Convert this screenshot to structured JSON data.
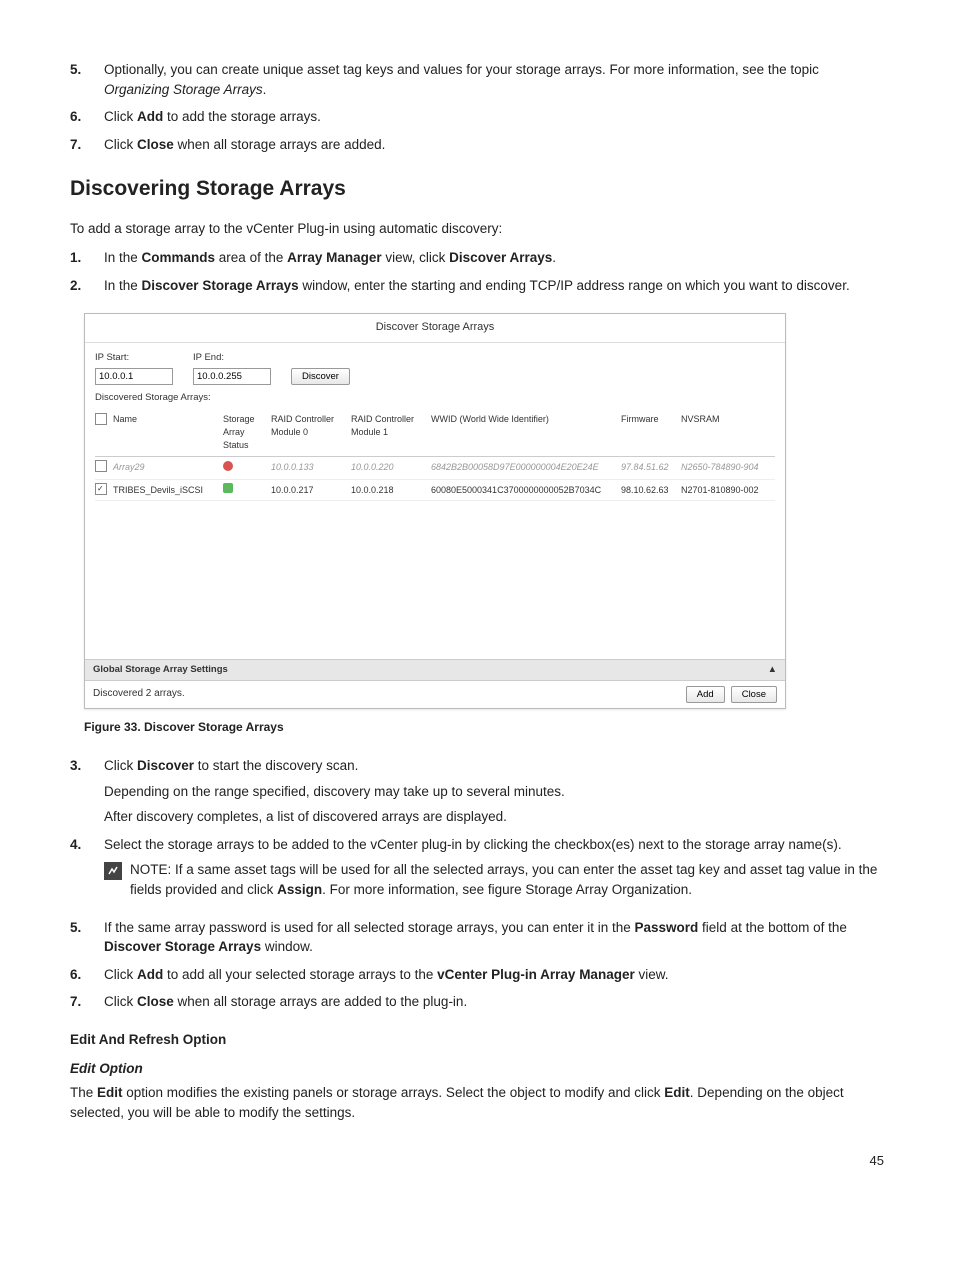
{
  "topSteps": {
    "s5": {
      "num": "5.",
      "text_a": "Optionally, you can create unique asset tag keys and values for your storage arrays. For more information, see the topic ",
      "text_b": "Organizing Storage Arrays",
      "text_c": "."
    },
    "s6": {
      "num": "6.",
      "a": "Click ",
      "b": "Add",
      "c": " to add the storage arrays."
    },
    "s7": {
      "num": "7.",
      "a": "Click ",
      "b": "Close",
      "c": " when all storage arrays are added."
    }
  },
  "section_title": "Discovering Storage Arrays",
  "intro": "To add a storage array to the vCenter Plug-in using automatic discovery:",
  "steps2": {
    "s1": {
      "num": "1.",
      "a": "In the ",
      "b": "Commands",
      "c": " area of the ",
      "d": "Array Manager",
      "e": " view, click ",
      "f": "Discover Arrays",
      "g": "."
    },
    "s2": {
      "num": "2.",
      "a": "In the ",
      "b": "Discover Storage Arrays",
      "c": " window, enter the starting and ending TCP/IP address range on which you want to discover."
    }
  },
  "screenshot": {
    "title": "Discover Storage Arrays",
    "ip_start_label": "IP Start:",
    "ip_start_value": "10.0.0.1",
    "ip_end_label": "IP End:",
    "ip_end_value": "10.0.0.255",
    "discover_btn": "Discover",
    "discovered_label": "Discovered Storage Arrays:",
    "headers": {
      "name": "Name",
      "status": "Storage Array Status",
      "m0": "RAID Controller Module 0",
      "m1": "RAID Controller Module 1",
      "wwid": "WWID (World Wide Identifier)",
      "fw": "Firmware",
      "nvsram": "NVSRAM"
    },
    "rows": [
      {
        "checked": false,
        "grey": true,
        "name": "Array29",
        "status": "bad",
        "m0": "10.0.0.133",
        "m1": "10.0.0.220",
        "wwid": "6842B2B00058D97E000000004E20E24E",
        "fw": "97.84.51.62",
        "nvsram": "N2650-784890-904"
      },
      {
        "checked": true,
        "grey": false,
        "name": "TRIBES_Devils_iSCSI",
        "status": "ok",
        "m0": "10.0.0.217",
        "m1": "10.0.0.218",
        "wwid": "60080E5000341C3700000000052B7034C",
        "fw": "98.10.62.63",
        "nvsram": "N2701-810890-002"
      }
    ],
    "global_label": "Global Storage Array Settings",
    "global_collapse": "▲",
    "status_text": "Discovered 2 arrays.",
    "add_btn": "Add",
    "close_btn": "Close"
  },
  "figure_caption": "Figure 33. Discover Storage Arrays",
  "steps3": {
    "s3": {
      "num": "3.",
      "a": "Click ",
      "b": "Discover",
      "c": " to start the discovery scan.",
      "line2": "Depending on the range specified, discovery may take up to several minutes.",
      "line3": "After discovery completes, a list of discovered arrays are displayed."
    },
    "s4": {
      "num": "4.",
      "text": "Select the storage arrays to be added to the vCenter plug-in by clicking the checkbox(es) next to the storage array name(s).",
      "note_label": "NOTE: ",
      "note_a": "If a same asset tags will be used for all the selected arrays, you can enter the asset tag key and asset tag value in the fields provided and click ",
      "note_b": "Assign",
      "note_c": ". For more information, see figure Storage Array Organization."
    },
    "s5": {
      "num": "5.",
      "a": "If the same array password is used for all selected storage arrays, you can enter it in the ",
      "b": "Password",
      "c": " field at the bottom of the ",
      "d": "Discover Storage Arrays",
      "e": " window."
    },
    "s6": {
      "num": "6.",
      "a": "Click ",
      "b": "Add",
      "c": " to add all your selected storage arrays to the ",
      "d": "vCenter Plug-in Array Manager",
      "e": " view."
    },
    "s7": {
      "num": "7.",
      "a": "Click ",
      "b": "Close",
      "c": " when all storage arrays are added to the plug-in."
    }
  },
  "edit_refresh_heading": "Edit And Refresh Option",
  "edit_option_heading": "Edit Option",
  "edit_para_a": "The ",
  "edit_para_b": "Edit",
  "edit_para_c": " option modifies the existing panels or storage arrays. Select the object to modify and click ",
  "edit_para_d": "Edit",
  "edit_para_e": ". Depending on the object selected, you will be able to modify the settings.",
  "page_number": "45"
}
